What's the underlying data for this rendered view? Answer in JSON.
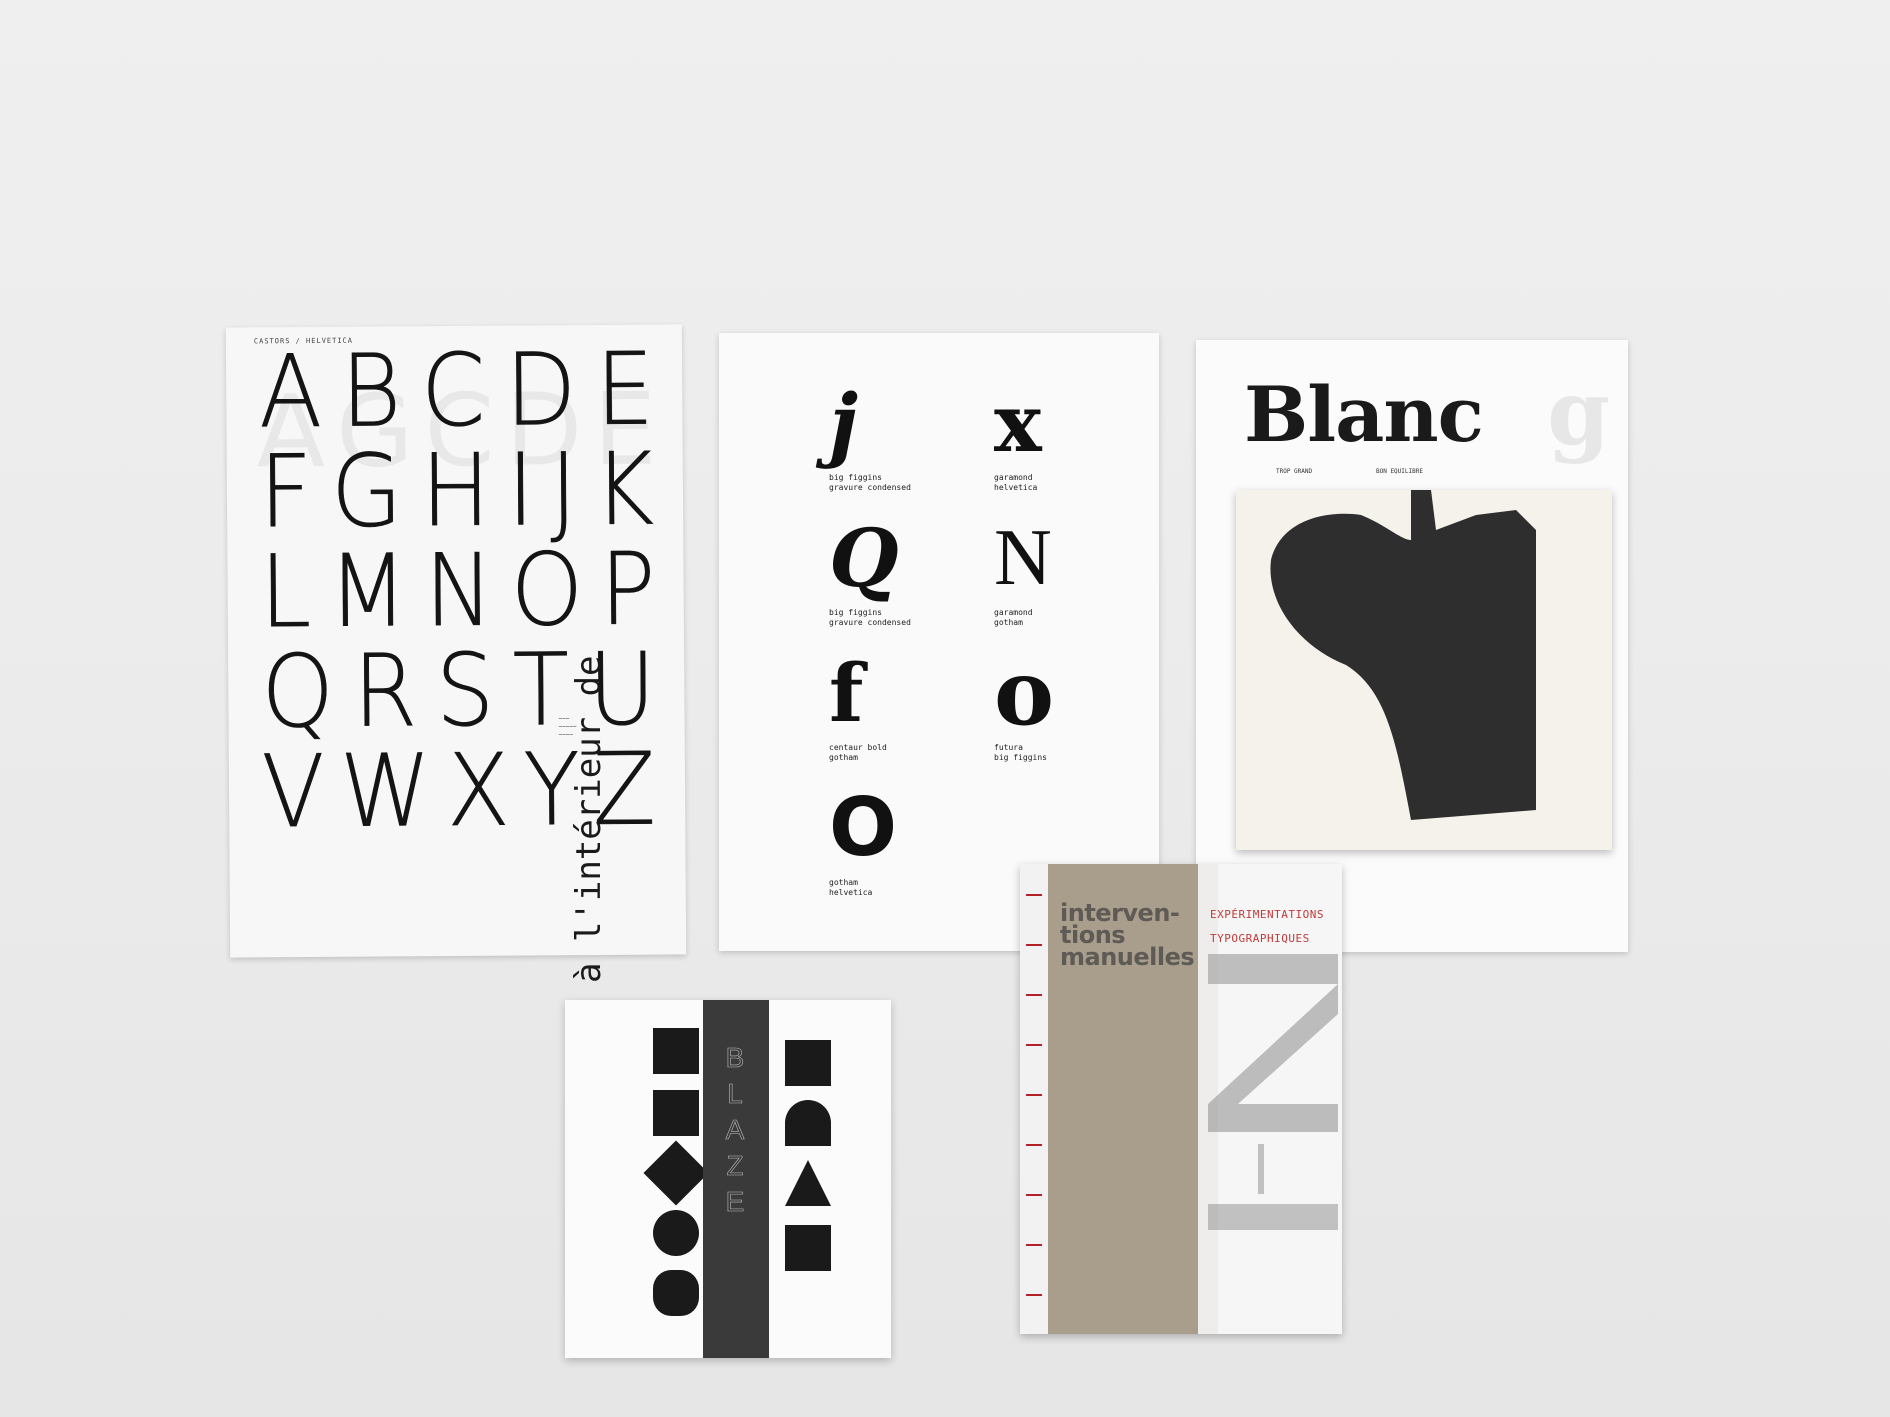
{
  "alphabet_sheet": {
    "header": "CASTORS / HELVETICA",
    "rows": [
      [
        "A",
        "B",
        "C",
        "D",
        "E"
      ],
      [
        "F",
        "G",
        "H",
        "I",
        "J",
        "K"
      ],
      [
        "L",
        "M",
        "N",
        "O",
        "P"
      ],
      [
        "Q",
        "R",
        "S",
        "T",
        "U"
      ],
      [
        "V",
        "W",
        "X",
        "Y",
        "Z"
      ]
    ]
  },
  "specimen_sheet": {
    "vertical_text": "à l'intérieur de",
    "cells": [
      {
        "glyph": "j",
        "caption": "big figgins\ngravure condensed"
      },
      {
        "glyph": "x",
        "caption": "garamond\nhelvetica"
      },
      {
        "glyph": "Q",
        "caption": "big figgins\ngravure condensed"
      },
      {
        "glyph": "N",
        "caption": "garamond\ngotham"
      },
      {
        "glyph": "f",
        "caption": "centaur bold\ngotham"
      },
      {
        "glyph": "o",
        "caption": "futura\nbig figgins"
      },
      {
        "glyph": "O",
        "caption": "gotham\nhelvetica"
      }
    ]
  },
  "blanc_sheet": {
    "word": "Blanc",
    "notes": [
      "TROP GRAND",
      "BON EQUILIBRE"
    ]
  },
  "blaze_booklet": {
    "band_letters": [
      "B",
      "L",
      "A",
      "Z",
      "E"
    ]
  },
  "interventions_booklet": {
    "title_line1": "interven-",
    "title_line2": "tions",
    "title_line3": "manuelles",
    "red_line1": "EXPÉRIMENTATIONS",
    "red_line2": "TYPOGRAPHIQUES"
  },
  "colors": {
    "wall": "#ececec",
    "ink": "#141414",
    "craft": "#a99d8c",
    "thread": "#b3202a",
    "red_text": "#c23a3a"
  }
}
